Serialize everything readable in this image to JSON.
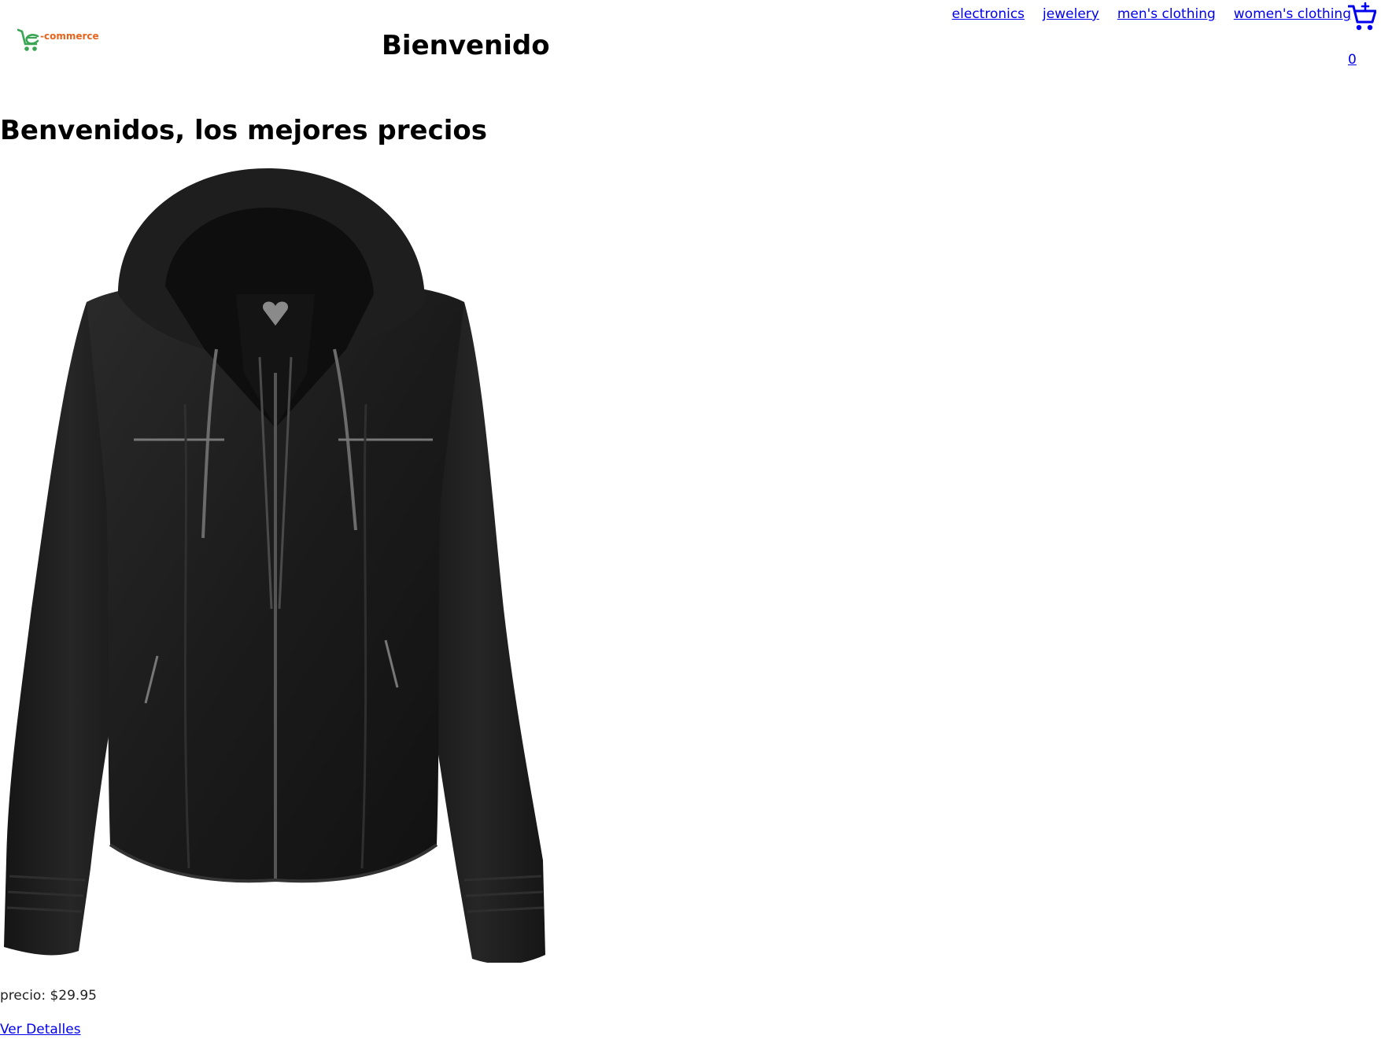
{
  "header": {
    "logo_text": "e-commerce",
    "title": "Bienvenido",
    "nav": [
      {
        "label": "electronics"
      },
      {
        "label": "jewelery"
      },
      {
        "label": "men's clothing"
      },
      {
        "label": "women's clothing"
      }
    ],
    "cart_count": "0"
  },
  "main": {
    "heading": "Benvenidos, los mejores precios",
    "product": {
      "image_icon": "black-hooded-jacket",
      "price_text": "precio: $29.95",
      "details_label": "Ver Detalles"
    }
  },
  "colors": {
    "link": "#0000ee",
    "logo_green": "#3aa655",
    "logo_orange": "#e8641c"
  }
}
